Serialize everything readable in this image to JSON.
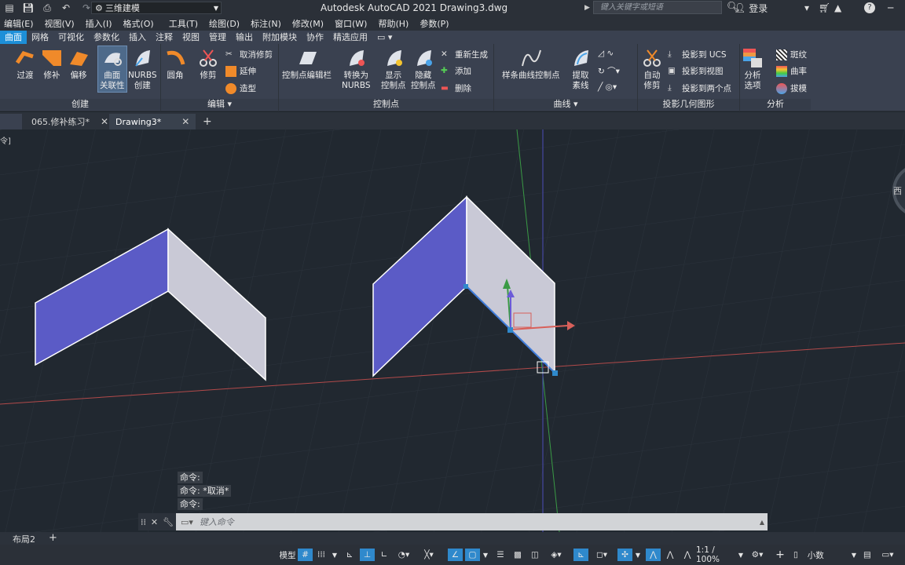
{
  "titlebar": {
    "workspace": "三维建模",
    "app_title": "Autodesk AutoCAD 2021    Drawing3.dwg",
    "search_placeholder": "键入关键字或短语",
    "login": "登录"
  },
  "menu": [
    "编辑(E)",
    "视图(V)",
    "插入(I)",
    "格式(O)",
    "工具(T)",
    "绘图(D)",
    "标注(N)",
    "修改(M)",
    "窗口(W)",
    "帮助(H)",
    "参数(P)"
  ],
  "ribbon_tabs": [
    "曲面",
    "网格",
    "可视化",
    "参数化",
    "插入",
    "注释",
    "视图",
    "管理",
    "输出",
    "附加模块",
    "协作",
    "精选应用"
  ],
  "ribbon": {
    "create": {
      "label": "创建",
      "buttons": [
        "过渡",
        "修补",
        "偏移"
      ],
      "assoc": [
        "曲面",
        "关联性"
      ],
      "nurbs": [
        "NURBS",
        "创建"
      ]
    },
    "edit": {
      "label": "编辑",
      "fillet": "圆角",
      "trim": "修剪",
      "untrim": "取消修剪",
      "extend": "延伸",
      "sculpt": "造型"
    },
    "cv": {
      "label": "控制点",
      "editbar": "控制点编辑栏",
      "convert": [
        "转换为",
        "NURBS"
      ],
      "show": [
        "显示",
        "控制点"
      ],
      "hide": [
        "隐藏",
        "控制点"
      ],
      "rebuild": "重新生成",
      "add": "添加",
      "remove": "删除"
    },
    "curves": {
      "label": "曲线",
      "spline": "样条曲线控制点",
      "extract": [
        "提取",
        "素线"
      ]
    },
    "project": {
      "label": "投影几何图形",
      "autotrim": [
        "自动",
        "修剪"
      ],
      "ucs": "投影到 UCS",
      "view": "投影到视图",
      "two": "投影到两个点"
    },
    "analysis": {
      "label": "分析",
      "options": [
        "分析",
        "选项"
      ],
      "zebra": "斑纹",
      "curvature": "曲率",
      "draft": "拔模"
    }
  },
  "doc_tabs": [
    {
      "label": "065.修补练习*",
      "close": "✕"
    },
    {
      "label": "Drawing3*",
      "close": "✕"
    }
  ],
  "viewport": {
    "corner_label": "令]",
    "viewcube_label": "西"
  },
  "command": {
    "history": [
      "命令:",
      "命令: *取消*",
      "命令:"
    ],
    "placeholder": "键入命令"
  },
  "layout": {
    "tab": "布局2",
    "add": "+"
  },
  "status": {
    "model": "模型",
    "scale": "1:1 / 100%",
    "units": "小数"
  },
  "colors": {
    "surface_dark": "#5b5bc6",
    "surface_light": "#c9c9d6",
    "x_axis": "#c04a4a",
    "y_axis": "#3fa64a",
    "accent": "#1d8fd8"
  }
}
